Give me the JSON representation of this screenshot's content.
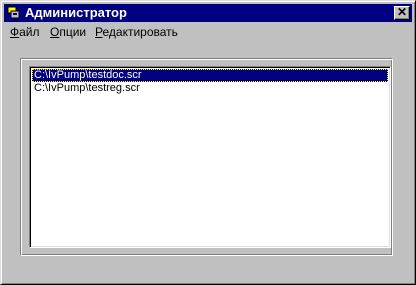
{
  "window": {
    "title": "Администратор",
    "close_symbol": "✕"
  },
  "menu": [
    {
      "hotkey": "Ф",
      "rest": "айл"
    },
    {
      "hotkey": "О",
      "rest": "пции"
    },
    {
      "hotkey": "Р",
      "rest": "едактировать"
    }
  ],
  "list": {
    "items": [
      {
        "text": "C:\\IvPump\\testdoc.scr",
        "selected": true
      },
      {
        "text": "C:\\IvPump\\testreg.scr",
        "selected": false
      }
    ]
  },
  "colors": {
    "titlebar": "#000080",
    "face": "#c0c0c0",
    "selection": "#000080"
  }
}
